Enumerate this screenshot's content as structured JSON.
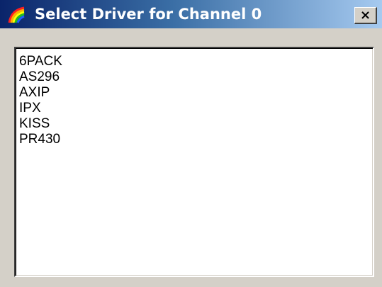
{
  "window": {
    "title": "Select Driver for Channel 0",
    "close_label": "×"
  },
  "drivers": [
    "6PACK",
    "AS296",
    "AXIP",
    "IPX",
    "KISS",
    "PR430"
  ],
  "icons": {
    "app": "rainbow-app-icon",
    "close": "close-icon"
  }
}
